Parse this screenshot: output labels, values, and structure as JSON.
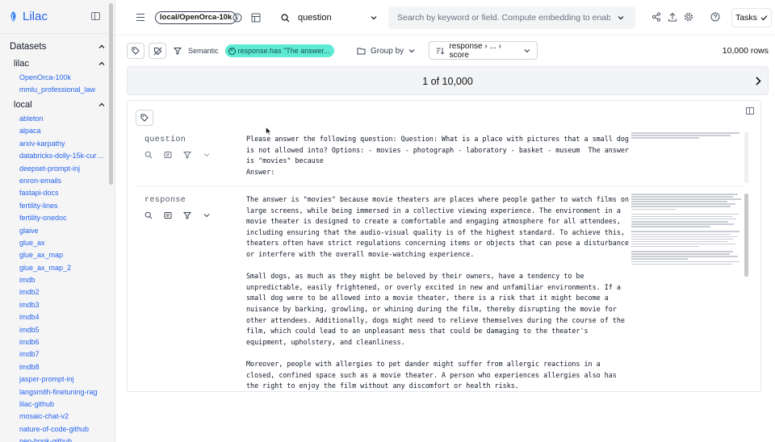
{
  "app": {
    "name": "Lilac"
  },
  "sidebar": {
    "datasets_title": "Datasets",
    "groups": [
      {
        "title": "lilac",
        "items": [
          "OpenOrca-100k",
          "mmlu_professional_law"
        ]
      },
      {
        "title": "local",
        "items": [
          "ableton",
          "alpaca",
          "arxiv-karpathy",
          "databricks-dolly-15k-cura...",
          "deepset-prompt-inj",
          "enron-emails",
          "fastapi-docs",
          "fertility-lines",
          "fertility-onedoc",
          "glaive",
          "glue_ax",
          "glue_ax_map",
          "glue_ax_map_2",
          "imdb",
          "imdb2",
          "imdb3",
          "imdb4",
          "imdb5",
          "imdb6",
          "imdb7",
          "imdb8",
          "jasper-prompt-inj",
          "langsmith-finetuning-rag",
          "lilac-github",
          "mosaic-chat-v2",
          "nature-of-code-github",
          "neo-hook-github"
        ]
      }
    ]
  },
  "topbar": {
    "dataset": "local/OpenOrca-10k",
    "search_field": "question",
    "search_placeholder": "Search by keyword or field. Compute embedding to enable cor",
    "tasks_label": "Tasks"
  },
  "filterbar": {
    "semantic_label": "Semantic",
    "filter_chip": "response.has \"The answer...",
    "group_by_label": "Group by",
    "sort_label": "response › ... › score",
    "row_count": "10,000 rows"
  },
  "pager": {
    "label": "1 of 10,000"
  },
  "record": {
    "question": {
      "label": "question",
      "text": "Please answer the following question: Question: What is a place with pictures that a small dog is not allowed into? Options: - movies - photograph - laboratory - basket - museum  The answer is \"movies\" because\nAnswer:"
    },
    "response": {
      "label": "response",
      "text": "The answer is \"movies\" because movie theaters are places where people gather to watch films on large screens, while being immersed in a collective viewing experience. The environment in a movie theater is designed to create a comfortable and engaging atmosphere for all attendees, including ensuring that the audio-visual quality is of the highest standard. To achieve this, theaters often have strict regulations concerning items or objects that can pose a disturbance or interfere with the overall movie-watching experience.\n\nSmall dogs, as much as they might be beloved by their owners, have a tendency to be unpredictable, easily frightened, or overly excited in new and unfamiliar environments. If a small dog were to be allowed into a movie theater, there is a risk that it might become a nuisance by barking, growling, or whining during the film, thereby disrupting the movie for other attendees. Additionally, dogs might need to relieve themselves during the course of the film, which could lead to an unpleasant mess that could be damaging to the theater's equipment, upholstery, and cleanliness.\n\nMoreover, people with allergies to pet dander might suffer from allergic reactions in a closed, confined space such as a movie theater. A person who experiences allergies also has the right to enjoy the film without any discomfort or health risks."
    }
  },
  "icons": [
    "lilac-logo",
    "sidebar-collapse-icon",
    "menu-icon",
    "info-icon",
    "schema-icon",
    "search-icon",
    "chevron-down-icon",
    "share-icon",
    "upload-icon",
    "gear-icon",
    "help-icon",
    "check-icon",
    "tag-icon",
    "tag-off-icon",
    "filter-icon",
    "folder-icon",
    "sort-icon",
    "chevron-right-icon",
    "expand-icon"
  ],
  "colors": {
    "accent": "#2563eb",
    "chip": "#5eead4",
    "chip_text": "#134e4a"
  }
}
